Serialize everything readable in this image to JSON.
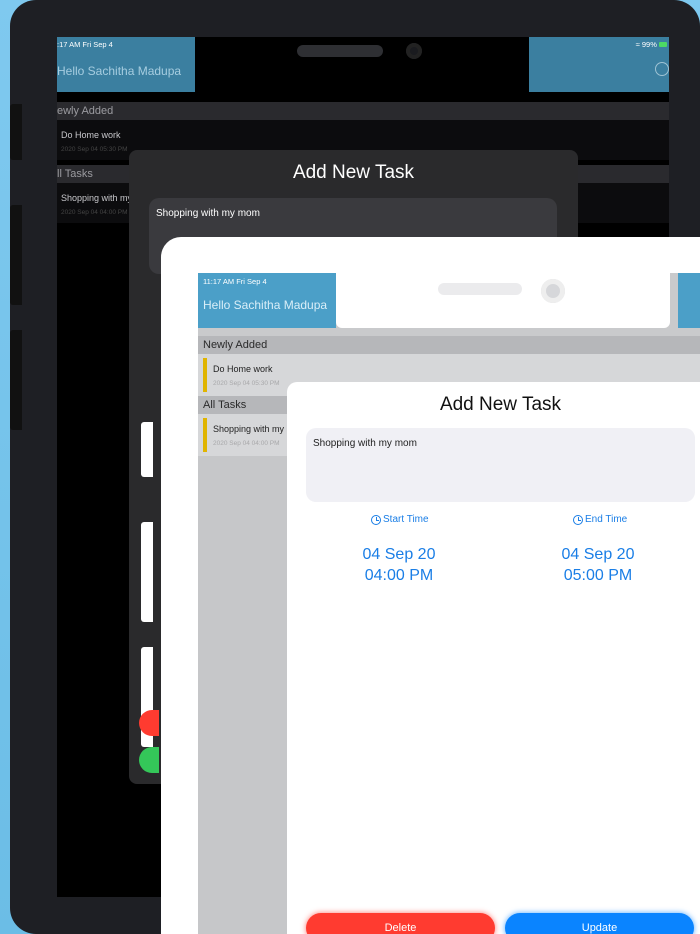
{
  "back_device": {
    "status_time": ":17 AM   Fri Sep 4",
    "battery": "99%",
    "greeting": "Hello Sachitha Madupa",
    "sections": {
      "newly_added": "ewly Added",
      "all_tasks": "ll Tasks"
    },
    "tasks": {
      "newly": {
        "title": "Do Home work",
        "subtitle": "2020 Sep 04 05:30 PM"
      },
      "all": {
        "title": "Shopping with my",
        "subtitle": "2020 Sep 04 04:00 PM"
      }
    },
    "modal": {
      "title": "Add New Task",
      "task_text": "Shopping with my mom"
    }
  },
  "front_device": {
    "status_time": "11:17 AM   Fri Sep 4",
    "greeting": "Hello Sachitha Madupa",
    "sections": {
      "newly_added": "Newly Added",
      "all_tasks": "All Tasks"
    },
    "tasks": {
      "newly": {
        "title": "Do Home work",
        "subtitle": "2020 Sep 04 05:30 PM"
      },
      "all": {
        "title": "Shopping with my",
        "subtitle": "2020 Sep 04 04:00 PM"
      }
    }
  },
  "modal": {
    "title": "Add New Task",
    "task_text": "Shopping with my mom",
    "start_label": "Start Time",
    "end_label": "End Time",
    "start_date": "04 Sep 20",
    "start_time": "04:00 PM",
    "end_date": "04 Sep 20",
    "end_time": "05:00 PM",
    "delete_label": "Delete",
    "update_label": "Update"
  },
  "colors": {
    "accent_blue": "#0a84ff",
    "delete_red": "#ff3b30",
    "header_blue": "#4b9fc8",
    "task_bar": "#e0b400"
  }
}
